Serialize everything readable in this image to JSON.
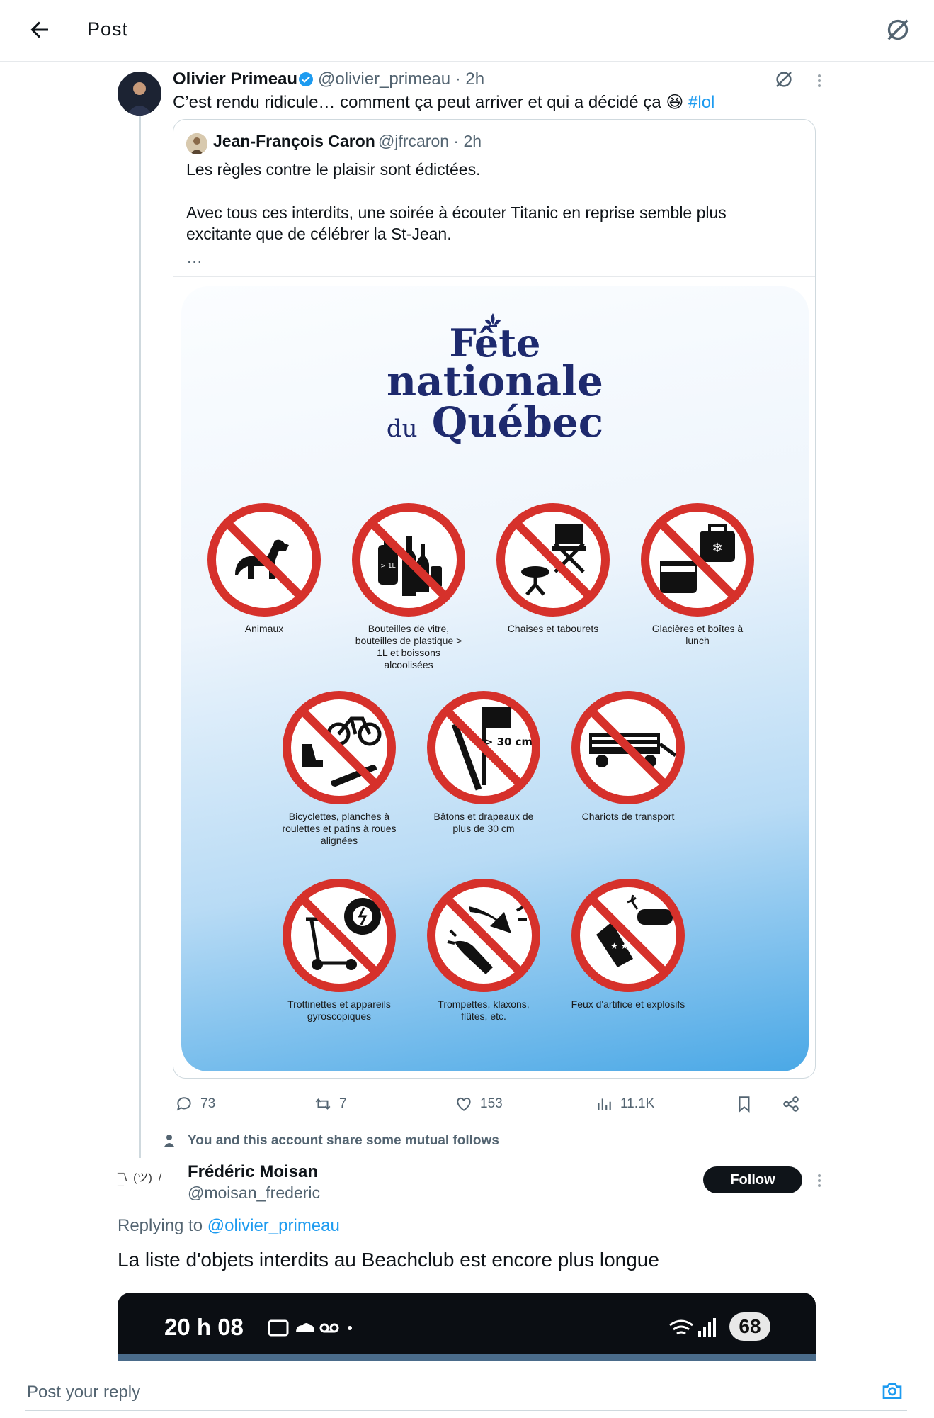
{
  "header": {
    "title": "Post",
    "back_icon": "back-arrow-icon",
    "grok_icon": "grok-icon"
  },
  "post": {
    "author_name": "Olivier Primeau",
    "verified": true,
    "handle_time": "@olivier_primeau · 2h",
    "text": "C’est rendu ridicule… comment ça peut arriver et qui a décidé ça 😆",
    "hashtag": "#lol",
    "quote": {
      "author_name": "Jean-François Caron",
      "handle_time": "@jfrcaron · 2h",
      "line1": "Les règles contre le plaisir sont édictées.",
      "line2": "Avec tous ces interdits, une soirée à écouter Titanic en reprise semble plus",
      "line3": "excitante que de célébrer la St-Jean.",
      "line4": "…",
      "poster": {
        "title1": "Fête",
        "title2": "nationale",
        "title3_small": "du",
        "title3": "Québec",
        "signs": [
          {
            "caption": "Animaux"
          },
          {
            "caption": "Bouteilles de vitre, bouteilles de plastique > 1L et boissons alcoolisées",
            "label": "> 1L"
          },
          {
            "caption": "Chaises et tabourets"
          },
          {
            "caption": "Glacières et boîtes à lunch"
          },
          {
            "caption": "Bicyclettes, planches à roulettes et patins à roues alignées"
          },
          {
            "caption": "Bâtons et drapeaux de plus de 30 cm",
            "label": "> 30 cm"
          },
          {
            "caption": "Chariots de transport"
          },
          {
            "caption": "Trottinettes et appareils gyroscopiques"
          },
          {
            "caption": "Trompettes, klaxons, flûtes, etc."
          },
          {
            "caption": "Feux d'artifice et explosifs"
          }
        ],
        "prohibition_color": "#d6312b"
      }
    },
    "actions": {
      "replies": "73",
      "reposts": "7",
      "likes": "153",
      "views": "11.1K"
    }
  },
  "mutual_note": "You and this account share some mutual follows",
  "reply": {
    "avatar_text": "¯\\_(ツ)_/¯",
    "author_name": "Frédéric Moisan",
    "handle": "@moisan_frederic",
    "follow_label": "Follow",
    "replying_prefix": "Replying to",
    "replying_mention": "@olivier_primeau",
    "text": "La liste d'objets interdits au Beachclub est encore plus longue",
    "media": {
      "time": "20 h 08",
      "battery": "68"
    }
  },
  "composer": {
    "placeholder": "Post your reply",
    "camera_icon": "camera-icon"
  },
  "colors": {
    "accent": "#1d9bf0",
    "text": "#0f1419",
    "muted": "#536471",
    "border": "#cfd9de"
  }
}
